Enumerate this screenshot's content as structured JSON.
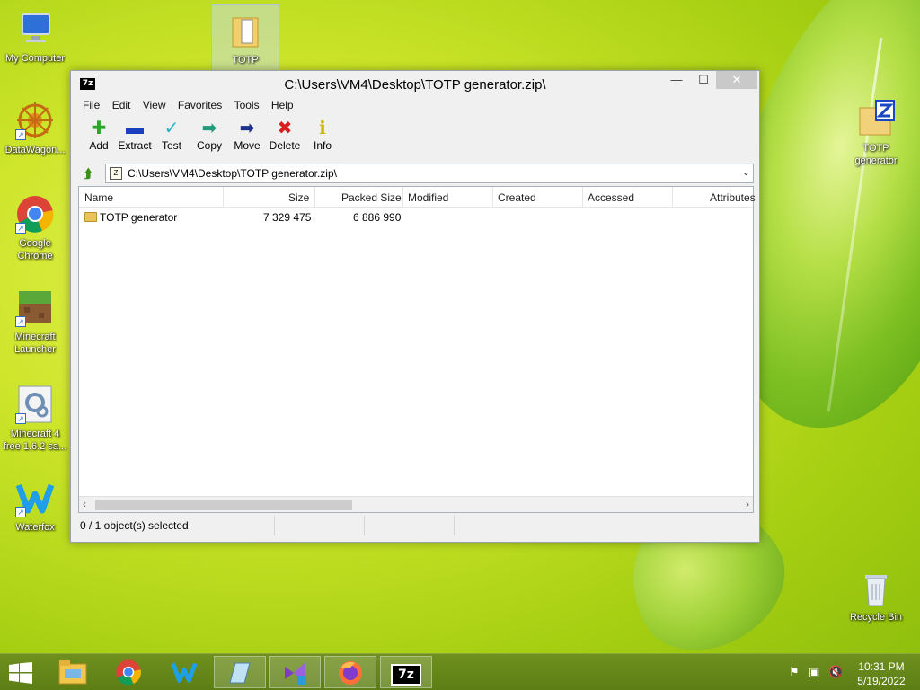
{
  "desktop": {
    "icons": [
      {
        "label": "My Computer"
      },
      {
        "label": "DataWagon..."
      },
      {
        "label": "Google Chrome"
      },
      {
        "label": "Minecraft Launcher"
      },
      {
        "label": "Minecraft 4 free 1.6.2 sa..."
      },
      {
        "label": "Waterfox"
      }
    ],
    "top_icon_label": "TOTP",
    "right_icons": [
      {
        "label": "TOTP generator"
      },
      {
        "label": "Recycle Bin"
      }
    ]
  },
  "window": {
    "app_badge": "7z",
    "title": "C:\\Users\\VM4\\Desktop\\TOTP generator.zip\\",
    "controls": {
      "minimize": "—",
      "maximize": "☐",
      "close": "✕"
    },
    "menu": [
      "File",
      "Edit",
      "View",
      "Favorites",
      "Tools",
      "Help"
    ],
    "toolbar": [
      {
        "label": "Add",
        "icon": "plus-icon",
        "color": "#2aa52a"
      },
      {
        "label": "Extract",
        "icon": "minus-icon",
        "color": "#1a3fbf"
      },
      {
        "label": "Test",
        "icon": "check-icon",
        "color": "#2bb3c8"
      },
      {
        "label": "Copy",
        "icon": "copy-arrow-icon",
        "color": "#1f9a7a"
      },
      {
        "label": "Move",
        "icon": "move-arrow-icon",
        "color": "#1a2f8f"
      },
      {
        "label": "Delete",
        "icon": "delete-x-icon",
        "color": "#d81e1e"
      },
      {
        "label": "Info",
        "icon": "info-icon",
        "color": "#c9b700"
      }
    ],
    "address": {
      "path": "C:\\Users\\VM4\\Desktop\\TOTP generator.zip\\",
      "dropdown": "⌄"
    },
    "columns": [
      "Name",
      "Size",
      "Packed Size",
      "Modified",
      "Created",
      "Accessed",
      "Attributes"
    ],
    "rows": [
      {
        "name": "TOTP generator",
        "size": "7 329 475",
        "packed": "6 886 990",
        "modified": "",
        "created": "",
        "accessed": "",
        "attributes": ""
      }
    ],
    "status": "0 / 1 object(s) selected"
  },
  "taskbar": {
    "items": [
      "file-explorer",
      "chrome",
      "waterfox",
      "notepad",
      "visual-studio-installer",
      "firefox",
      "7zip"
    ],
    "clock_time": "10:31 PM",
    "clock_date": "5/19/2022"
  }
}
